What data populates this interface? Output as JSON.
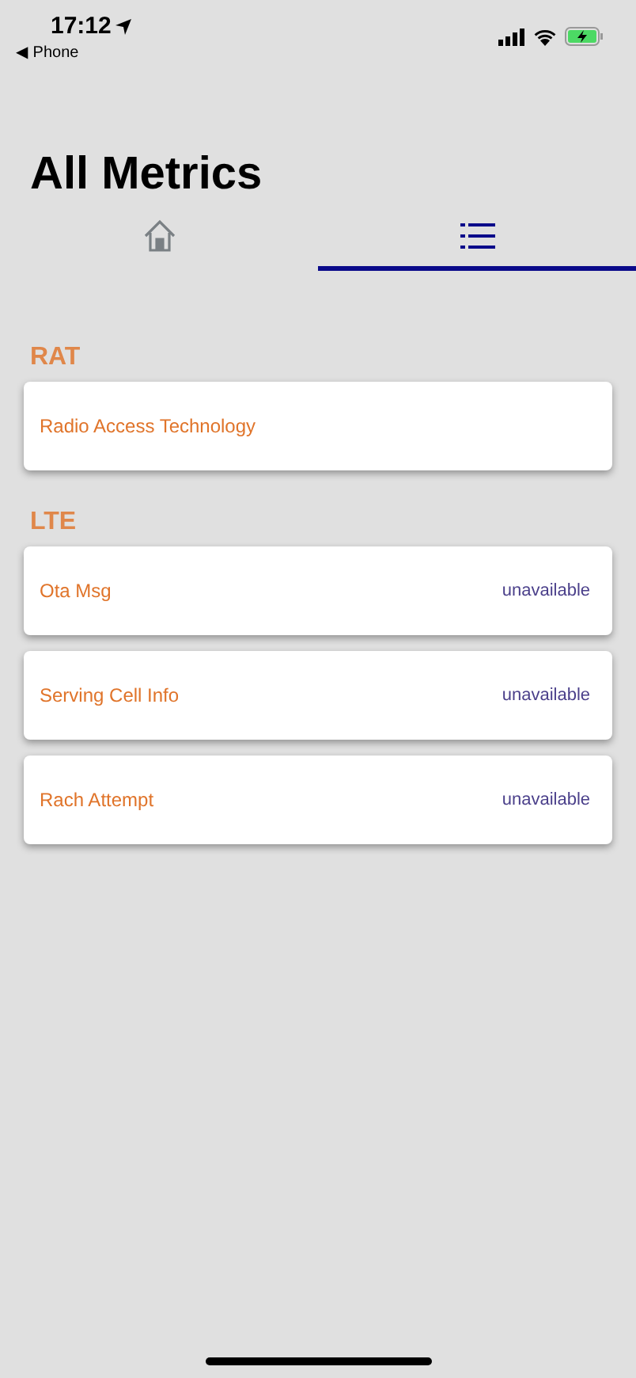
{
  "status_bar": {
    "time": "17:12",
    "back_label": "◀ Phone"
  },
  "title": "All Metrics",
  "tabs": [
    {
      "kind": "home",
      "selected": false
    },
    {
      "kind": "list",
      "selected": true
    }
  ],
  "sections": [
    {
      "heading": "RAT",
      "items": [
        {
          "label": "Radio Access Technology"
        }
      ]
    },
    {
      "heading": "LTE",
      "items": [
        {
          "label": "Ota Msg",
          "value": "unavailable"
        },
        {
          "label": "Serving Cell Info",
          "value": "unavailable"
        },
        {
          "label": "Rach Attempt",
          "value": "unavailable"
        }
      ]
    }
  ]
}
